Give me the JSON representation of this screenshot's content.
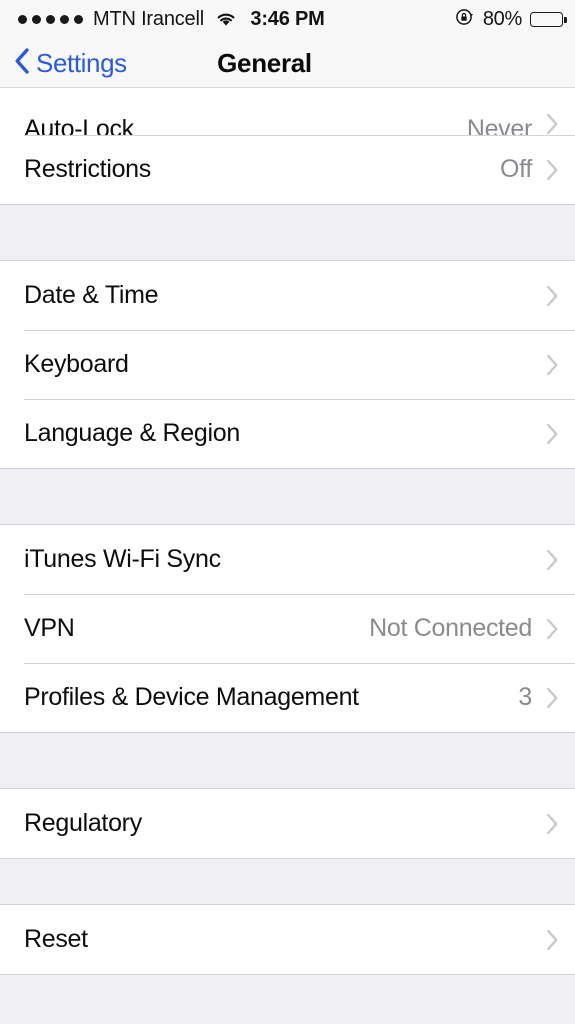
{
  "status_bar": {
    "signal_dots": 5,
    "carrier": "MTN Irancell",
    "wifi_icon": "wifi-icon",
    "time": "3:46 PM",
    "rotation_lock_icon": "rotation-lock-icon",
    "battery_percent": "80%",
    "battery_level": 80
  },
  "nav_bar": {
    "back_label": "Settings",
    "back_icon": "chevron-left-icon",
    "title": "General"
  },
  "colors": {
    "accent_blue": "#2D5BD7",
    "background_gray": "#EFEFF4",
    "row_white": "#FFFFFF",
    "value_gray": "#8A8A8F",
    "chevron_gray": "#C7C7CC",
    "separator": "#D4D4D8"
  },
  "groups": [
    {
      "clipped_top": true,
      "rows": [
        {
          "label": "Auto-Lock",
          "value": "Never",
          "chevron": true,
          "clipped": true
        },
        {
          "label": "Restrictions",
          "value": "Off",
          "chevron": true
        }
      ]
    },
    {
      "rows": [
        {
          "label": "Date & Time",
          "value": "",
          "chevron": true
        },
        {
          "label": "Keyboard",
          "value": "",
          "chevron": true
        },
        {
          "label": "Language & Region",
          "value": "",
          "chevron": true
        }
      ]
    },
    {
      "rows": [
        {
          "label": "iTunes Wi-Fi Sync",
          "value": "",
          "chevron": true
        },
        {
          "label": "VPN",
          "value": "Not Connected",
          "chevron": true
        },
        {
          "label": "Profiles & Device Management",
          "value": "3",
          "chevron": true
        }
      ]
    },
    {
      "rows": [
        {
          "label": "Regulatory",
          "value": "",
          "chevron": true
        }
      ]
    },
    {
      "rows": [
        {
          "label": "Reset",
          "value": "",
          "chevron": true
        }
      ]
    }
  ]
}
